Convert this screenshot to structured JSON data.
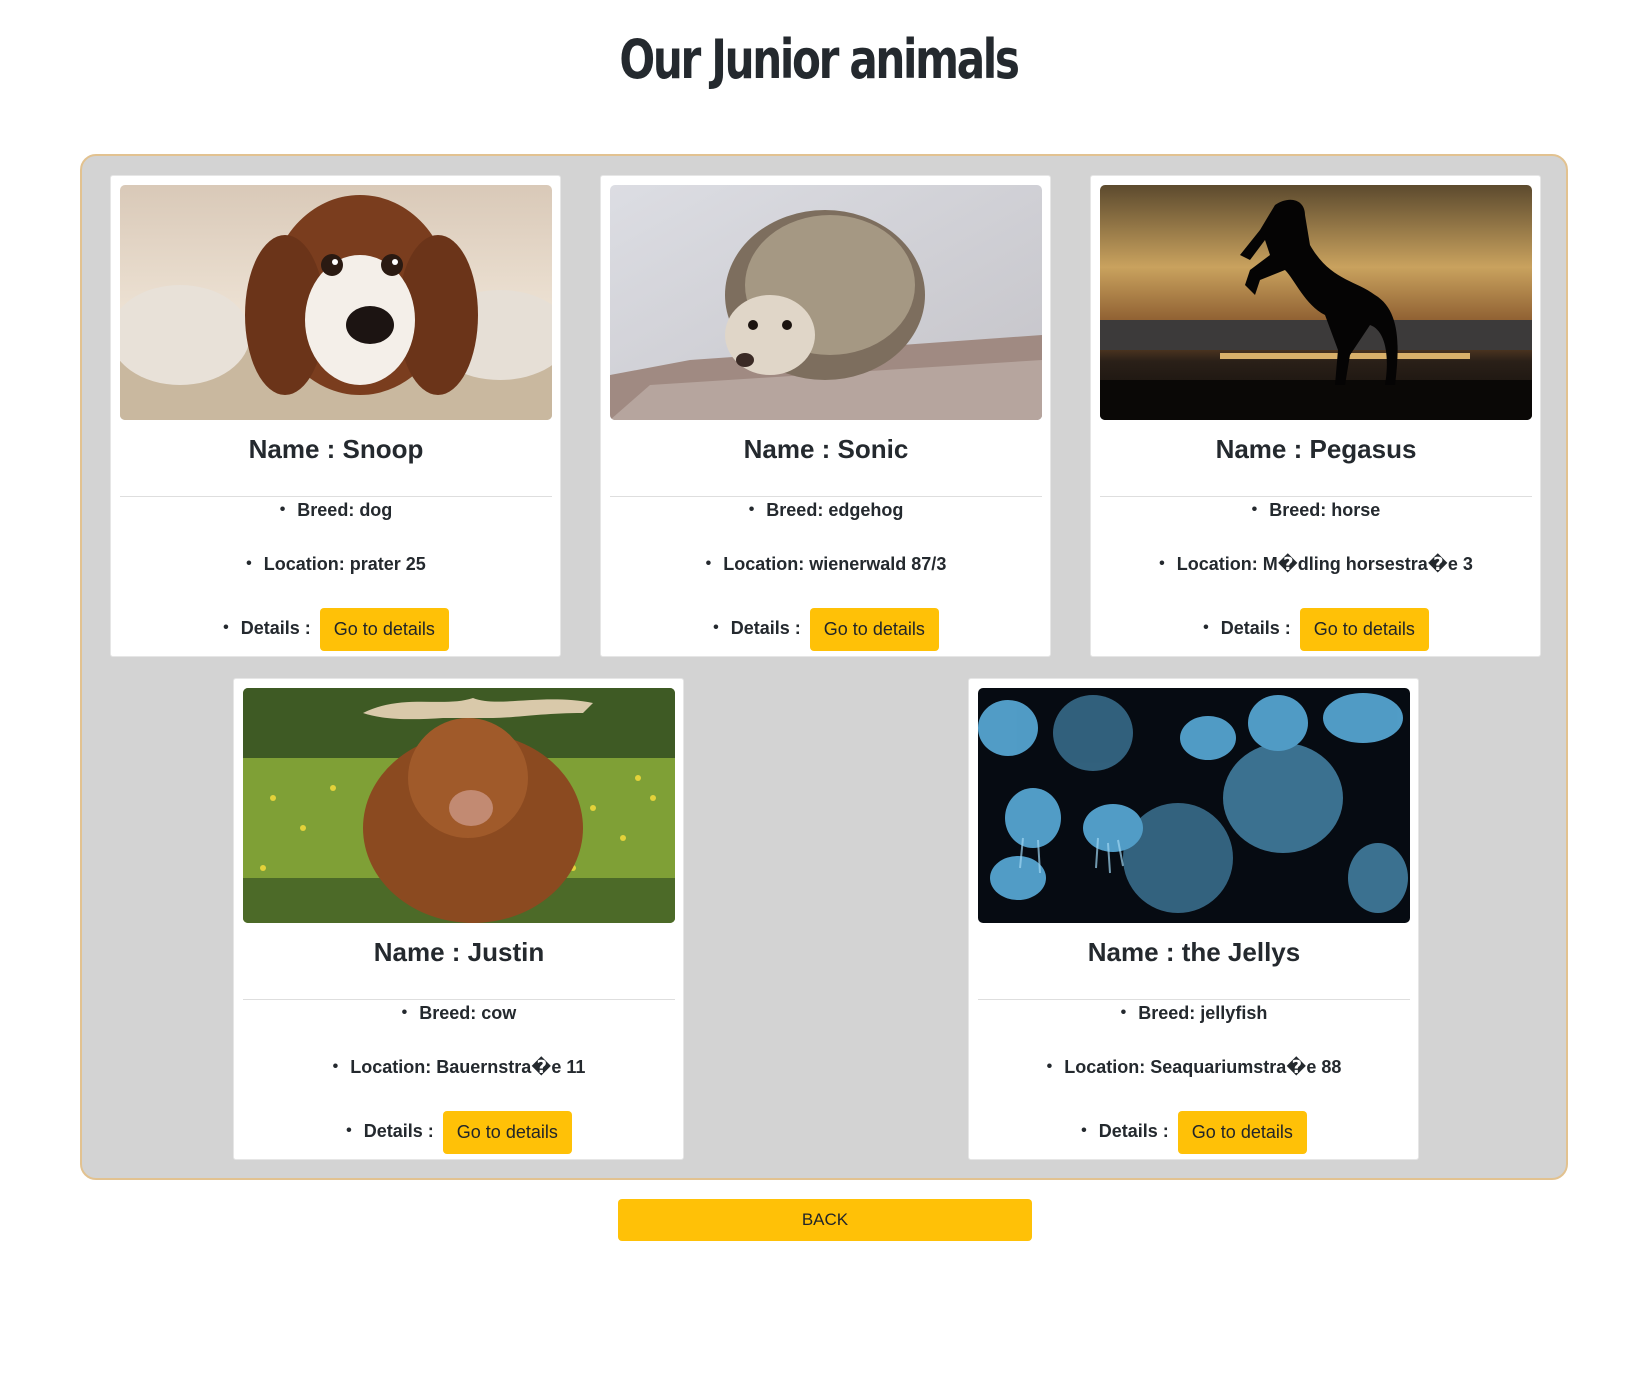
{
  "page": {
    "title": "Our Junior animals",
    "back_label": "BACK"
  },
  "cards": [
    {
      "name": "Name : Snoop",
      "breed": "Breed: dog",
      "location": "Location: prater 25",
      "details_label": "Details :",
      "button_label": "Go to details",
      "image": "dog-photo"
    },
    {
      "name": "Name : Sonic",
      "breed": "Breed: edgehog",
      "location": "Location: wienerwald 87/3",
      "details_label": "Details :",
      "button_label": "Go to details",
      "image": "hedgehog-photo"
    },
    {
      "name": "Name : Pegasus",
      "breed": "Breed: horse",
      "location": "Location: M�dling horsestra�e 3",
      "details_label": "Details :",
      "button_label": "Go to details",
      "image": "horse-silhouette-photo"
    },
    {
      "name": "Name : Justin",
      "breed": "Breed: cow",
      "location": "Location: Bauernstra�e 11",
      "details_label": "Details :",
      "button_label": "Go to details",
      "image": "highland-cow-photo"
    },
    {
      "name": "Name : the Jellys",
      "breed": "Breed: jellyfish",
      "location": "Location: Seaquariumstra�e 88",
      "details_label": "Details :",
      "button_label": "Go to details",
      "image": "jellyfish-photo"
    }
  ],
  "colors": {
    "accent": "#ffc107",
    "panel_background": "#d3d3d3",
    "panel_border": "#e2c290",
    "text": "#212529"
  }
}
